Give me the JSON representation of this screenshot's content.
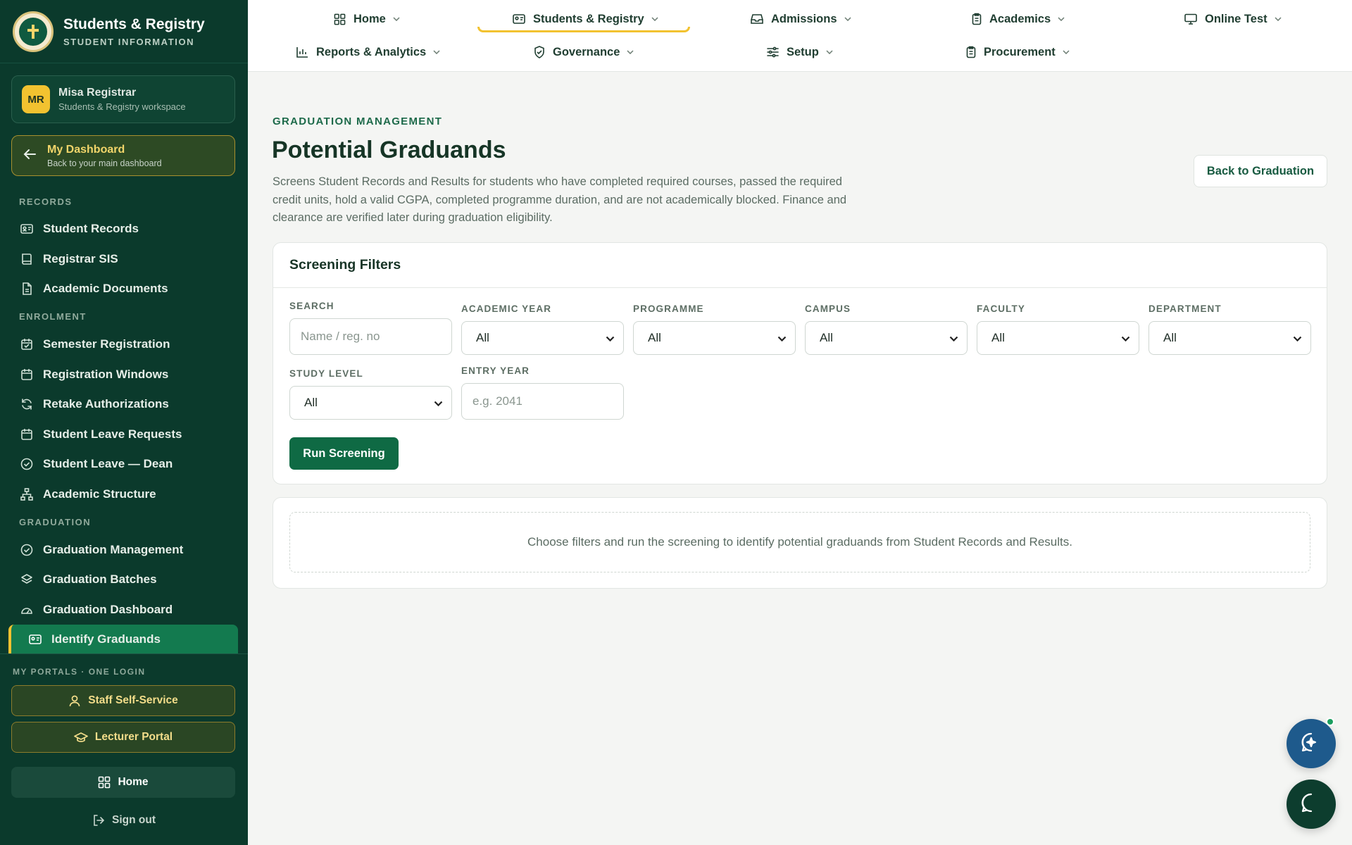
{
  "brand": {
    "title": "Students & Registry",
    "subtitle": "STUDENT INFORMATION"
  },
  "user": {
    "initials": "MR",
    "name": "Misa Registrar",
    "role": "Students & Registry workspace"
  },
  "dashboard": {
    "title": "My Dashboard",
    "subtitle": "Back to your main dashboard"
  },
  "sidebar": {
    "sections": [
      {
        "label": "RECORDS",
        "items": [
          {
            "label": "Student Records",
            "icon": "id-card-icon"
          },
          {
            "label": "Registrar SIS",
            "icon": "book-icon"
          },
          {
            "label": "Academic Documents",
            "icon": "document-icon"
          }
        ]
      },
      {
        "label": "ENROLMENT",
        "items": [
          {
            "label": "Semester Registration",
            "icon": "calendar-check-icon"
          },
          {
            "label": "Registration Windows",
            "icon": "calendar-icon"
          },
          {
            "label": "Retake Authorizations",
            "icon": "refresh-icon"
          },
          {
            "label": "Student Leave Requests",
            "icon": "calendar-icon"
          },
          {
            "label": "Student Leave — Dean",
            "icon": "check-circle-icon"
          },
          {
            "label": "Academic Structure",
            "icon": "hierarchy-icon"
          }
        ]
      },
      {
        "label": "GRADUATION",
        "items": [
          {
            "label": "Graduation Management",
            "icon": "check-circle-icon"
          },
          {
            "label": "Graduation Batches",
            "icon": "layers-icon"
          },
          {
            "label": "Graduation Dashboard",
            "icon": "gauge-icon"
          },
          {
            "label": "Identify Graduands",
            "icon": "id-card-icon"
          }
        ]
      }
    ]
  },
  "portals": {
    "label": "MY PORTALS · ONE LOGIN",
    "staff": "Staff Self-Service",
    "lecturer": "Lecturer Portal",
    "home": "Home",
    "signout": "Sign out"
  },
  "topnav": {
    "items": [
      {
        "label": "Home",
        "icon": "grid-icon"
      },
      {
        "label": "Students & Registry",
        "icon": "id-card-icon"
      },
      {
        "label": "Admissions",
        "icon": "inbox-icon"
      },
      {
        "label": "Academics",
        "icon": "clipboard-icon"
      },
      {
        "label": "Online Test",
        "icon": "monitor-icon"
      },
      {
        "label": "Reports & Analytics",
        "icon": "bar-chart-icon"
      },
      {
        "label": "Governance",
        "icon": "shield-check-icon"
      },
      {
        "label": "Setup",
        "icon": "sliders-icon"
      },
      {
        "label": "Procurement",
        "icon": "clipboard-icon"
      }
    ]
  },
  "page": {
    "eyebrow": "GRADUATION MANAGEMENT",
    "title": "Potential Graduands",
    "description": "Screens Student Records and Results for students who have completed required courses, passed the required credit units, hold a valid CGPA, completed programme duration, and are not academically blocked. Finance and clearance are verified later during graduation eligibility.",
    "back_button": "Back to Graduation"
  },
  "filters": {
    "title": "Screening Filters",
    "search": {
      "label": "SEARCH",
      "placeholder": "Name / reg. no"
    },
    "academic_year": {
      "label": "ACADEMIC YEAR",
      "value": "All"
    },
    "programme": {
      "label": "PROGRAMME",
      "value": "All"
    },
    "campus": {
      "label": "CAMPUS",
      "value": "All"
    },
    "faculty": {
      "label": "FACULTY",
      "value": "All"
    },
    "department": {
      "label": "DEPARTMENT",
      "value": "All"
    },
    "study_level": {
      "label": "STUDY LEVEL",
      "value": "All"
    },
    "entry_year": {
      "label": "ENTRY YEAR",
      "placeholder": "e.g. 2041"
    },
    "run_button": "Run Screening"
  },
  "empty_state": "Choose filters and run the screening to identify potential graduands from Student Records and Results.",
  "colors": {
    "sidebar": "#0b3a2c",
    "accent": "#f2c230",
    "primary": "#0f6a44"
  }
}
